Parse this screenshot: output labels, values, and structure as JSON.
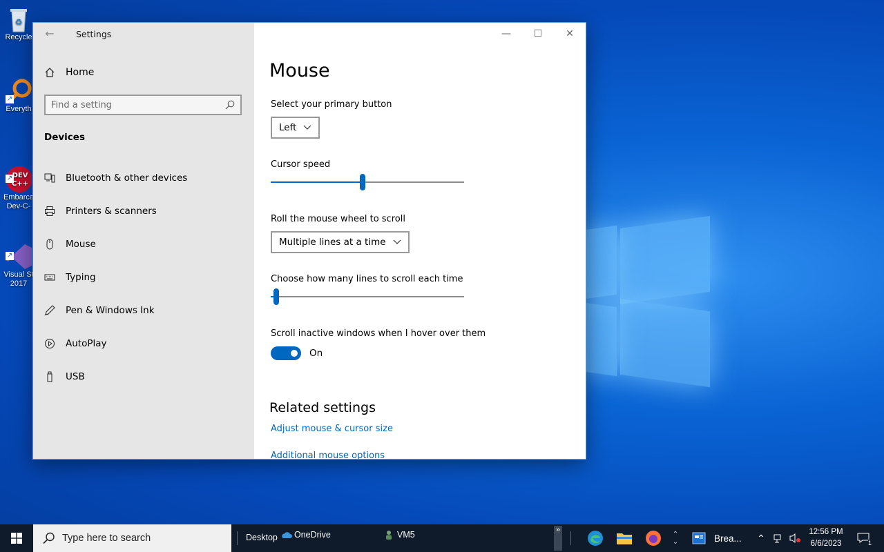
{
  "desktop": {
    "icons": [
      {
        "label": "Recycle"
      },
      {
        "label": "Everyth"
      },
      {
        "label": "Embarca\nDev-C-"
      },
      {
        "label": "Visual St\n2017"
      }
    ]
  },
  "window": {
    "app_title": "Settings",
    "controls": {
      "minimize": "—",
      "maximize": "☐",
      "close": "✕"
    }
  },
  "sidebar": {
    "home_label": "Home",
    "search_placeholder": "Find a setting",
    "section_title": "Devices",
    "items": [
      {
        "label": "Bluetooth & other devices",
        "icon": "bluetooth-devices-icon"
      },
      {
        "label": "Printers & scanners",
        "icon": "printer-icon"
      },
      {
        "label": "Mouse",
        "icon": "mouse-icon"
      },
      {
        "label": "Typing",
        "icon": "keyboard-icon"
      },
      {
        "label": "Pen & Windows Ink",
        "icon": "pen-icon"
      },
      {
        "label": "AutoPlay",
        "icon": "autoplay-icon"
      },
      {
        "label": "USB",
        "icon": "usb-icon"
      }
    ]
  },
  "main": {
    "title": "Mouse",
    "primary_button": {
      "label": "Select your primary button",
      "value": "Left"
    },
    "cursor_speed": {
      "label": "Cursor speed",
      "value": 0.475
    },
    "wheel_scroll": {
      "label": "Roll the mouse wheel to scroll",
      "value": "Multiple lines at a time"
    },
    "lines_to_scroll": {
      "label": "Choose how many lines to scroll each time",
      "value": 0.03
    },
    "scroll_inactive": {
      "label": "Scroll inactive windows when I hover over them",
      "state": "On"
    },
    "related": {
      "title": "Related settings",
      "links": [
        "Adjust mouse & cursor size",
        "Additional mouse options"
      ]
    }
  },
  "taskbar": {
    "search_label": "Type here to search",
    "desktop_label": "Desktop",
    "onedrive_label": "OneDrive",
    "vm_label": "VM5",
    "overflow_label": "»",
    "active_app_label": "Brea...",
    "time": "12:56 PM",
    "date": "6/6/2023",
    "notification_count": "1",
    "colors": {
      "accent": "#0067c0",
      "taskbar": "#0f1a2a"
    }
  }
}
